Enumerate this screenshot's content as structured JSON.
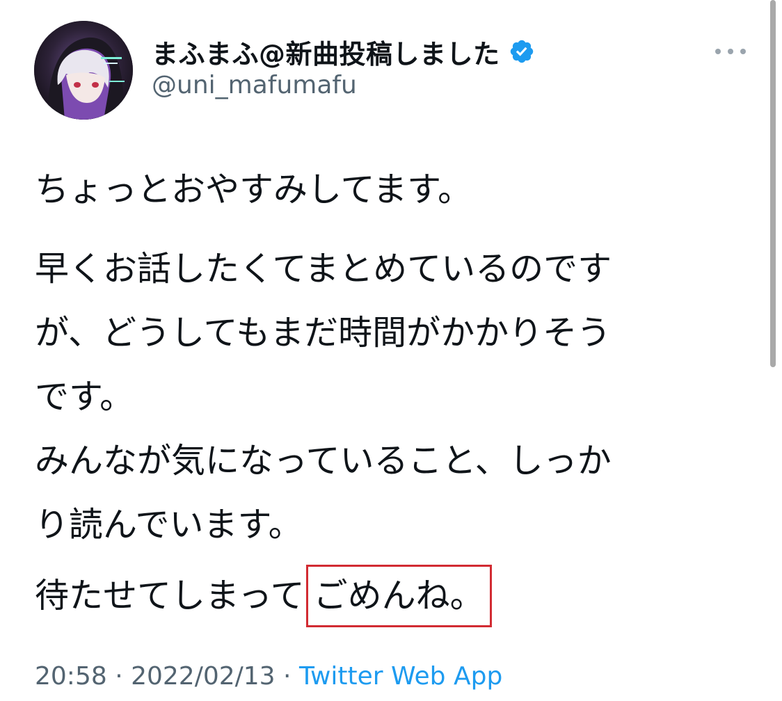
{
  "author": {
    "display_name": "まふまふ@新曲投稿しました",
    "handle": "@uni_mafumafu",
    "verified": true,
    "avatar_icon": "avatar-image",
    "verified_color": "#1d9bf0"
  },
  "more_icon": "more-horizontal-icon",
  "tweet": {
    "line1": "ちょっとおやすみしてます。",
    "line2": "早くお話したくてまとめているのです",
    "line3": "が、どうしてもまだ時間がかかりそう",
    "line4": "です。",
    "line5": "みんなが気になっていること、しっか",
    "line6": "り読んでいます。",
    "line7_prefix": "待たせてしまって",
    "line7_highlight": "ごめんね。"
  },
  "meta": {
    "time": "20:58",
    "separator1": " · ",
    "date": "2022/02/13",
    "separator2": " · ",
    "source": "Twitter Web App"
  },
  "colors": {
    "text": "#0f1419",
    "secondary": "#536471",
    "link": "#1d9bf0",
    "highlight_box": "#d22b32"
  }
}
